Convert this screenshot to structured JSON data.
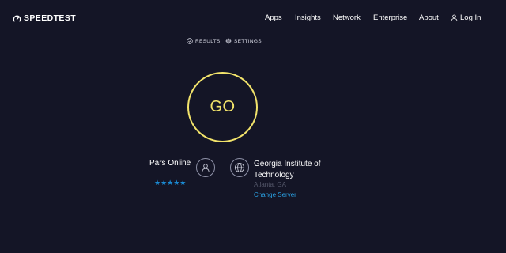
{
  "brand": {
    "name": "SPEEDTEST"
  },
  "nav": {
    "items": [
      "Apps",
      "Insights",
      "Network",
      "Enterprise",
      "About"
    ],
    "login_label": "Log In"
  },
  "subnav": {
    "results_label": "RESULTS",
    "settings_label": "SETTINGS"
  },
  "go_button": {
    "label": "GO"
  },
  "isp": {
    "name": "Pars Online",
    "rating_stars": 5,
    "stars": "★★★★★"
  },
  "server": {
    "name": "Georgia Institute of Technology",
    "location": "Atlanta, GA",
    "change_label": "Change Server"
  },
  "colors": {
    "background": "#141526",
    "accent": "#f2e36b",
    "link": "#2aa3e6",
    "star": "#1b8ad3"
  },
  "icons": {
    "logo": "speedometer-icon",
    "login": "user-icon",
    "results": "check-circle-icon",
    "settings": "gear-icon",
    "isp": "person-icon",
    "server": "globe-icon"
  }
}
